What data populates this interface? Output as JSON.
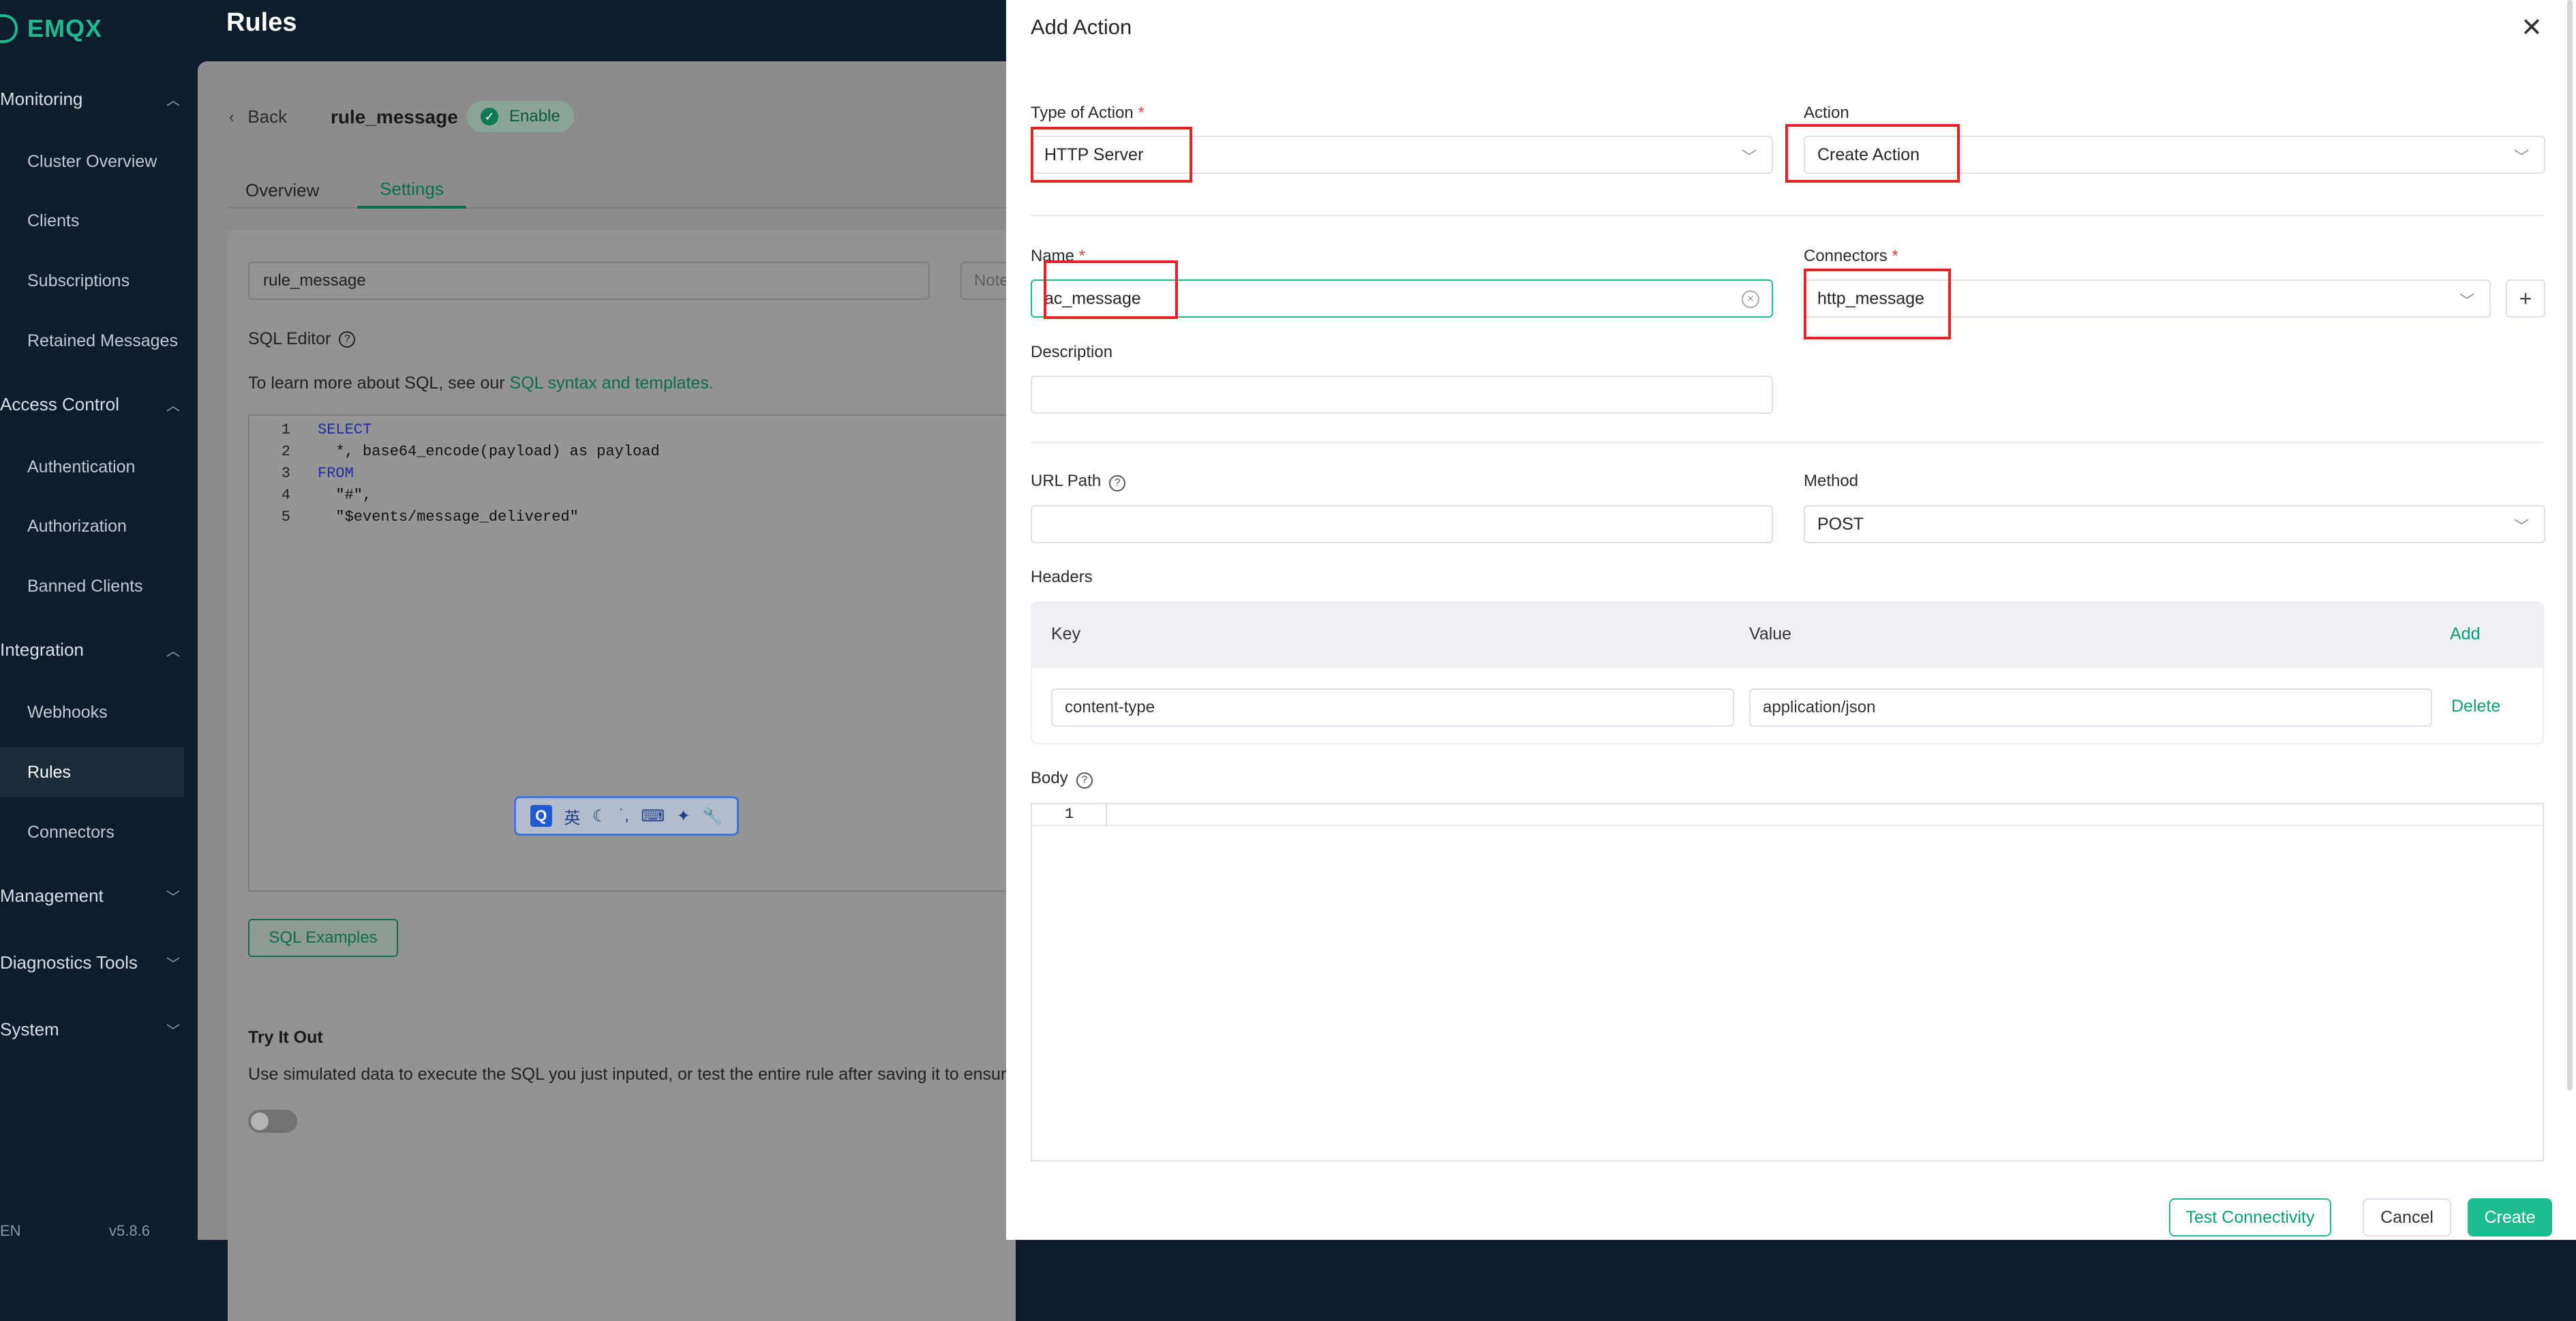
{
  "sidebar": {
    "brand": "EMQX",
    "groups": [
      {
        "label": "Monitoring",
        "items": [
          "Cluster Overview",
          "Clients",
          "Subscriptions",
          "Retained Messages"
        ]
      },
      {
        "label": "Access Control",
        "items": [
          "Authentication",
          "Authorization",
          "Banned Clients"
        ]
      },
      {
        "label": "Integration",
        "items": [
          "Webhooks",
          "Rules",
          "Connectors"
        ]
      },
      {
        "label": "Management"
      },
      {
        "label": "Diagnostics Tools"
      },
      {
        "label": "System"
      }
    ],
    "active_item": "Rules",
    "version_left": "EN",
    "version_right": "v5.8.6"
  },
  "header": {
    "title": "Rules"
  },
  "rule_page": {
    "back_label": "Back",
    "rule_name": "rule_message",
    "status": "Enable",
    "tabs": [
      "Overview",
      "Settings"
    ],
    "active_tab": "Settings",
    "name_value": "rule_message",
    "note_placeholder": "Note",
    "sql_editor_label": "SQL Editor",
    "sql_hint_prefix": "To learn more about SQL, see our ",
    "sql_hint_link": "SQL syntax and templates.",
    "sql_lines": [
      {
        "n": "1",
        "text": "SELECT"
      },
      {
        "n": "2",
        "text": "  *, base64_encode(payload) as payload"
      },
      {
        "n": "3",
        "text": "FROM"
      },
      {
        "n": "4",
        "text": "  \"#\","
      },
      {
        "n": "5",
        "text": "  \"$events/message_delivered\""
      }
    ],
    "sql_examples_label": "SQL Examples",
    "try_title": "Try It Out",
    "try_desc": "Use simulated data to execute the SQL you just inputed, or test the entire rule after saving it to ensure"
  },
  "ime_toolbar": {
    "q": "Q",
    "lang": "英"
  },
  "drawer": {
    "title": "Add Action",
    "type_label": "Type of Action",
    "type_value": "HTTP Server",
    "action_label": "Action",
    "action_value": "Create Action",
    "name_label": "Name",
    "name_value": "ac_message",
    "connectors_label": "Connectors",
    "connectors_value": "http_message",
    "description_label": "Description",
    "description_value": "",
    "url_label": "URL Path",
    "url_value": "",
    "method_label": "Method",
    "method_value": "POST",
    "headers_label": "Headers",
    "headers_columns": {
      "key": "Key",
      "value": "Value",
      "add": "Add"
    },
    "headers_rows": [
      {
        "key": "content-type",
        "value": "application/json",
        "delete": "Delete"
      }
    ],
    "body_label": "Body",
    "body_line": "1",
    "buttons": {
      "test": "Test Connectivity",
      "cancel": "Cancel",
      "create": "Create"
    }
  },
  "colors": {
    "accent": "#1dbb8e",
    "highlight": "#e62222",
    "required": "#e0403b",
    "sidebar_bg": "#0d1d2c"
  }
}
